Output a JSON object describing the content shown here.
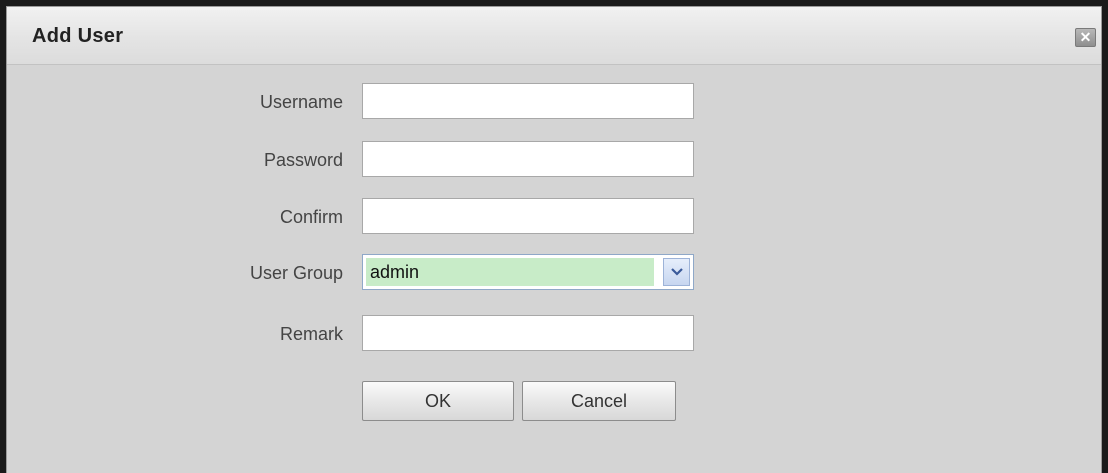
{
  "dialog": {
    "title": "Add User",
    "close_icon": "close-icon"
  },
  "form": {
    "username": {
      "label": "Username",
      "value": ""
    },
    "password": {
      "label": "Password",
      "value": ""
    },
    "confirm": {
      "label": "Confirm",
      "value": ""
    },
    "user_group": {
      "label": "User Group",
      "selected": "admin"
    },
    "remark": {
      "label": "Remark",
      "value": ""
    }
  },
  "buttons": {
    "ok_label": "OK",
    "cancel_label": "Cancel"
  },
  "colors": {
    "dialog_background": "#d4d4d4",
    "select_highlight": "#c8ecc8"
  }
}
